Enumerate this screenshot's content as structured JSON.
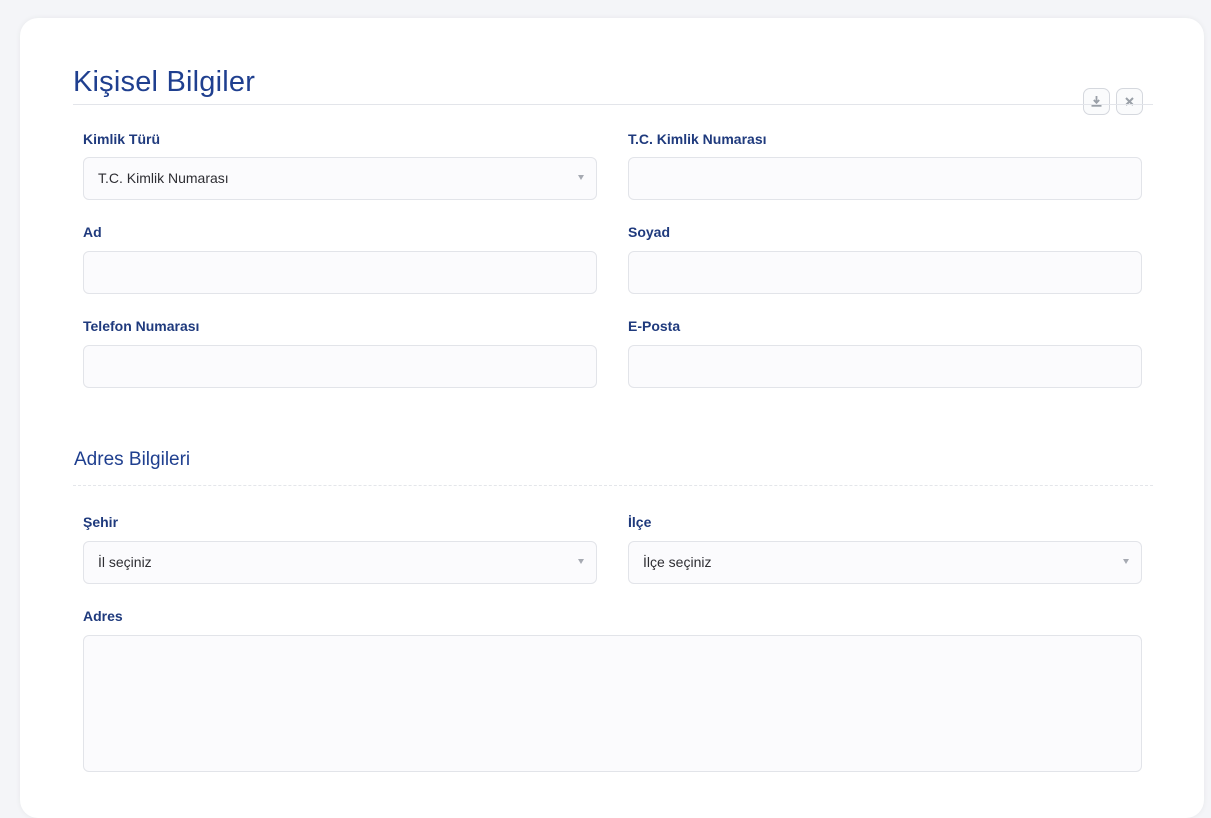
{
  "title": "Kişisel Bilgiler",
  "toolbar": {
    "download_icon": "download-icon",
    "close_icon": "close-icon"
  },
  "personal": {
    "id_type": {
      "label": "Kimlik Türü",
      "value": "T.C. Kimlik Numarası"
    },
    "tc_number": {
      "label": "T.C. Kimlik Numarası",
      "value": ""
    },
    "first_name": {
      "label": "Ad",
      "value": ""
    },
    "last_name": {
      "label": "Soyad",
      "value": ""
    },
    "phone": {
      "label": "Telefon Numarası",
      "value": ""
    },
    "email": {
      "label": "E-Posta",
      "value": ""
    }
  },
  "address": {
    "title": "Adres Bilgileri",
    "city": {
      "label": "Şehir",
      "value": "İl seçiniz"
    },
    "district": {
      "label": "İlçe",
      "value": "İlçe seçiniz"
    },
    "address": {
      "label": "Adres",
      "value": ""
    }
  },
  "colors": {
    "heading": "#1f3f8f",
    "label": "#1f3a7d",
    "field_border": "#e2e4e9",
    "field_bg": "#fbfbfd"
  }
}
